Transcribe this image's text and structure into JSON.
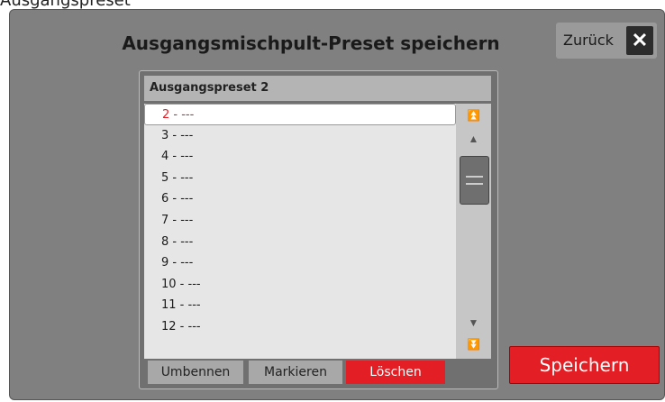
{
  "top_text": "Ausgangspreset",
  "window": {
    "title": "Ausgangsmischpult-Preset speichern"
  },
  "back": {
    "label": "Zurück",
    "icon": "✕"
  },
  "preset_header": "Ausgangspreset 2",
  "list": {
    "items": [
      {
        "label": "2 - ---",
        "selected": true
      },
      {
        "label": "3 - ---"
      },
      {
        "label": "4 - ---"
      },
      {
        "label": "5 - ---"
      },
      {
        "label": "6 - ---"
      },
      {
        "label": "7 - ---"
      },
      {
        "label": "8 - ---"
      },
      {
        "label": "9 - ---"
      },
      {
        "label": "10 - ---"
      },
      {
        "label": "11 - ---"
      },
      {
        "label": "12 - ---"
      }
    ]
  },
  "scroll": {
    "top_icon": "⏫",
    "up_icon": "▲",
    "down_icon": "▼",
    "bottom_icon": "⏬"
  },
  "buttons": {
    "rename": "Umbennen",
    "mark": "Markieren",
    "delete": "Löschen"
  },
  "save_label": "Speichern",
  "colors": {
    "accent_red": "#e31e24",
    "panel": "#808080",
    "list_bg": "#e6e6e6"
  }
}
